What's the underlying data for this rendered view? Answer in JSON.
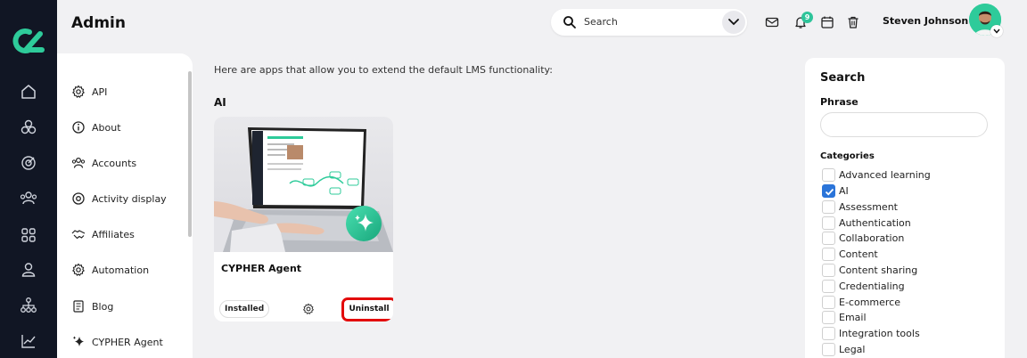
{
  "header": {
    "title": "Admin",
    "search_label": "Search",
    "notification_count": "9",
    "user_name": "Steven Johnson"
  },
  "rail": {
    "icons": [
      "home-icon",
      "courses-icon",
      "target-icon",
      "users-group-icon",
      "grid-icon",
      "user-icon",
      "hierarchy-icon",
      "chart-icon"
    ]
  },
  "nav": {
    "items": [
      {
        "label": "API",
        "icon": "gear-icon"
      },
      {
        "label": "About",
        "icon": "info-icon"
      },
      {
        "label": "Accounts",
        "icon": "accounts-icon"
      },
      {
        "label": "Activity display",
        "icon": "activity-icon"
      },
      {
        "label": "Affiliates",
        "icon": "handshake-icon"
      },
      {
        "label": "Automation",
        "icon": "gear-icon"
      },
      {
        "label": "Blog",
        "icon": "blog-icon"
      },
      {
        "label": "CYPHER Agent",
        "icon": "sparkle-icon"
      }
    ]
  },
  "main": {
    "intro": "Here are apps that allow you to extend the default LMS functionality:",
    "section_title": "AI",
    "app": {
      "name": "CYPHER Agent",
      "status": "Installed",
      "action": "Uninstall"
    }
  },
  "filters": {
    "title": "Search",
    "phrase_label": "Phrase",
    "phrase_value": "",
    "categories_label": "Categories",
    "categories": [
      {
        "label": "Advanced learning",
        "checked": false
      },
      {
        "label": "AI",
        "checked": true
      },
      {
        "label": "Assessment",
        "checked": false
      },
      {
        "label": "Authentication",
        "checked": false
      },
      {
        "label": "Collaboration",
        "checked": false
      },
      {
        "label": "Content",
        "checked": false
      },
      {
        "label": "Content sharing",
        "checked": false
      },
      {
        "label": "Credentialing",
        "checked": false
      },
      {
        "label": "E-commerce",
        "checked": false
      },
      {
        "label": "Email",
        "checked": false
      },
      {
        "label": "Integration tools",
        "checked": false
      },
      {
        "label": "Legal",
        "checked": false
      }
    ]
  },
  "colors": {
    "rail": "#111624",
    "accent": "#2ec49a",
    "highlight": "#e30b0b",
    "checkbox": "#2a74d9"
  }
}
